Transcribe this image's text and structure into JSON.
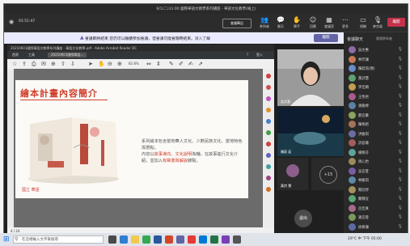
{
  "window": {
    "title": "6/1(二)11:00 國際華語文教學系列講座 - 華語文化教學(線上)"
  },
  "call": {
    "timer": "01:51:47"
  },
  "toolbar": {
    "leave": "離開",
    "buttons": [
      {
        "label": "參與者",
        "icon": "people-icon",
        "glyph": "👥"
      },
      {
        "label": "聊天",
        "icon": "chat-icon",
        "glyph": "💬"
      },
      {
        "label": "舉手",
        "icon": "hand-icon",
        "glyph": "✋"
      },
      {
        "label": "回應",
        "icon": "react-icon",
        "glyph": "☺"
      },
      {
        "label": "會議室",
        "icon": "rooms-icon",
        "glyph": "▦"
      },
      {
        "label": "更多",
        "icon": "more-icon",
        "glyph": "⋯"
      }
    ],
    "cam_label": "相機",
    "mic_label": "麥克風",
    "share_label": "分享"
  },
  "notice": {
    "text": "會議即將結束 您仍可以繼續參加會議，但會議可能會隨時結束。深入了解",
    "button": "離開"
  },
  "pdf": {
    "title": "20210601國際華語文教學系列講座 - 華語文化教學.pdf - Adobe Acrobat Reader DC",
    "tabs": [
      "首頁",
      "工具",
      "20210601國際華語..."
    ],
    "zoom": "82.8%",
    "page_status": "4 / 24",
    "slide": {
      "title": "繪本計畫內容簡介",
      "text_plain": "系列繪本包含當地華人文化、少數民族文化、當地特色與景點。",
      "text_emph_prefix": "內容以",
      "text_emph1": "故事導向、文化說明",
      "text_emph_mid": "為輔，在故事進行文化介紹，並加入",
      "text_emph2": "有聲書與解說",
      "text_suffix": "錄製。",
      "logo": "國立 華語"
    }
  },
  "video": {
    "speaker_name": "吳文惠",
    "second_name": "陳蔚 茹",
    "third_name": "黃詩 慧",
    "more_count": "+15",
    "raise_label": "退出"
  },
  "panel": {
    "title": "會議聊天",
    "invite": "邀請參與者",
    "participants": [
      {
        "name": "吳文惠",
        "color": "#8e6aa8"
      },
      {
        "name": "林芳珊",
        "color": "#c77a52"
      },
      {
        "name": "陳蔚茹(我)",
        "color": "#6b8cc7"
      },
      {
        "name": "黃詩慧",
        "color": "#5fa070"
      },
      {
        "name": "李佳穎",
        "color": "#c0a050"
      },
      {
        "name": "王怡君",
        "color": "#a55c8a"
      },
      {
        "name": "張雅婷",
        "color": "#5c7fa5"
      },
      {
        "name": "劉宜蓁",
        "color": "#8aa55c"
      },
      {
        "name": "陳俐君",
        "color": "#a5735c"
      },
      {
        "name": "洪雅琪",
        "color": "#6c6ca5"
      },
      {
        "name": "許庭瑜",
        "color": "#a55c5c"
      },
      {
        "name": "楊佩芬",
        "color": "#5ca59a"
      },
      {
        "name": "周心怡",
        "color": "#9a8a5c"
      },
      {
        "name": "吳宜萱",
        "color": "#7a5ca5"
      },
      {
        "name": "林雅琪",
        "color": "#5c8aa5"
      },
      {
        "name": "蔡欣妤",
        "color": "#a5905c"
      },
      {
        "name": "鄭靜宜",
        "color": "#5ca570"
      },
      {
        "name": "呂佳真",
        "color": "#a56a8a"
      },
      {
        "name": "謝宜蓉",
        "color": "#7a9a5c"
      },
      {
        "name": "徐佩珊",
        "color": "#5c6aa5"
      }
    ]
  },
  "taskbar": {
    "search": "在這裡輸入文字來搜尋",
    "tray": "29°C 中 下午 05:00"
  }
}
